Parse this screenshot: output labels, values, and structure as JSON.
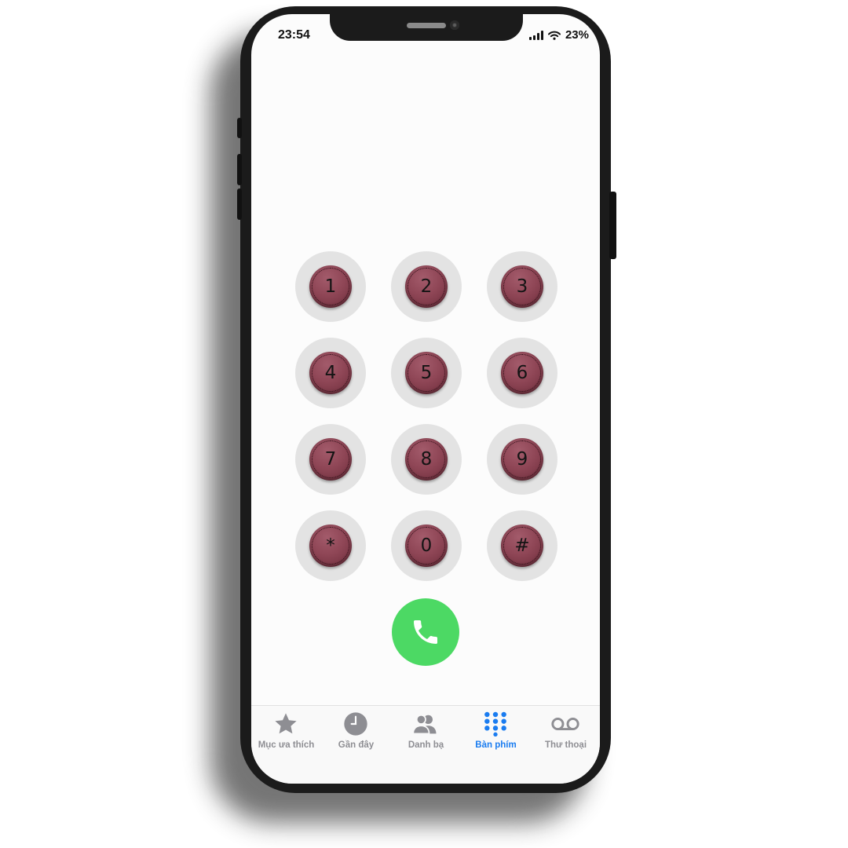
{
  "status_bar": {
    "time": "23:54",
    "battery": "23%"
  },
  "keypad": {
    "keys": [
      {
        "label": "1"
      },
      {
        "label": "2"
      },
      {
        "label": "3"
      },
      {
        "label": "4"
      },
      {
        "label": "5"
      },
      {
        "label": "6"
      },
      {
        "label": "7"
      },
      {
        "label": "8"
      },
      {
        "label": "9"
      },
      {
        "label": "*"
      },
      {
        "label": "0"
      },
      {
        "label": "#"
      }
    ],
    "key_color": "#8f4656",
    "key_ring_color": "#e3e3e3"
  },
  "call_button": {
    "icon": "phone-icon",
    "color": "#4cd964"
  },
  "tabbar": {
    "active_color": "#1a7cf0",
    "inactive_color": "#8e8e93",
    "tabs": [
      {
        "label": "Mục ưa thích",
        "icon": "star-icon"
      },
      {
        "label": "Gần đây",
        "icon": "clock-icon"
      },
      {
        "label": "Danh bạ",
        "icon": "contacts-icon"
      },
      {
        "label": "Bàn phím",
        "icon": "keypad-icon",
        "active": true
      },
      {
        "label": "Thư thoại",
        "icon": "voicemail-icon"
      }
    ]
  }
}
